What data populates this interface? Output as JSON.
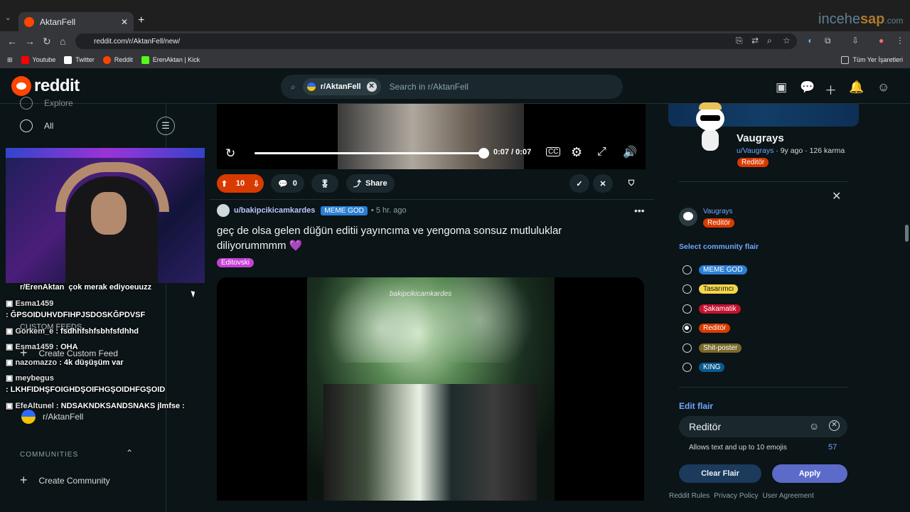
{
  "browser": {
    "tab_title": "AktanFell",
    "url": "reddit.com/r/AktanFell/new/",
    "bookmarks": [
      {
        "label": "Youtube",
        "color": "#ff0000"
      },
      {
        "label": "Twitter",
        "color": "#ffffff"
      },
      {
        "label": "Reddit",
        "color": "#ff4500"
      },
      {
        "label": "ErenAktan | Kick",
        "color": "#53fc18"
      }
    ],
    "bookmarks_folder": "Tüm Yer İşaretleri",
    "watermark_a": "incehe",
    "watermark_b": "sap",
    "watermark_c": ".com"
  },
  "header": {
    "logo": "reddit",
    "search_chip": "r/AktanFell",
    "search_placeholder": "Search in r/AktanFell"
  },
  "sidebar": {
    "explore": "Explore",
    "all": "All",
    "custom_feeds_head": "CUSTOM FEEDS",
    "create_custom_feed": "Create Custom Feed",
    "subreddit": "r/AktanFell",
    "subreddit_ghost": "r/ErenAktan",
    "communities_head": "COMMUNITIES",
    "create_community": "Create Community"
  },
  "stream_chat": [
    {
      "user": "",
      "msg": "çok merak ediyoeuuzz"
    },
    {
      "user": "Esma1459",
      "msg": ": ĞPSOIDUHVDFIHPJSDOSKĞPDVSF"
    },
    {
      "user": "Gorkem_e",
      "msg": ": fsdhhfshfsbhfsfdhhd"
    },
    {
      "user": "Esma1459",
      "msg": ": OHA"
    },
    {
      "user": "nazomazzo",
      "msg": ": 4k düşüşüm var"
    },
    {
      "user": "meybegus",
      "msg": ": LKHFIDHŞFOIGHDŞOIFHGŞOIDHFGŞOID"
    },
    {
      "user": "EfeAltunel",
      "msg": ": NDSAKNDKSANDSNAKS jlmfse :"
    }
  ],
  "video1": {
    "time": "0:07 / 0:07",
    "progress": 1.0
  },
  "post1_actions": {
    "votes": "10",
    "comments": "0",
    "share": "Share"
  },
  "post2": {
    "author": "u/bakipcikicamkardes",
    "author_flair": "MEME GOD",
    "time": "5 hr. ago",
    "title": "geç de olsa gelen düğün editii yayıncıma ve yengoma sonsuz mutluluklar diliyorummmm 💜",
    "post_flair": "Editovski",
    "video_watermark": "bakipcikicamkardes"
  },
  "profile": {
    "name": "Vaugrays",
    "username": "u/Vaugrays",
    "age": "9y ago",
    "karma": "126 karma",
    "flair": "Reditör"
  },
  "flair_panel": {
    "user": "Vaugrays",
    "user_flair": "Reditör",
    "select_title": "Select community flair",
    "options": [
      {
        "label": "MEME GOD",
        "bg": "#2a7fd4",
        "fg": "#ffffff",
        "selected": false
      },
      {
        "label": "Tasarımcı",
        "bg": "#f5d74b",
        "fg": "#1a1a1a",
        "selected": false
      },
      {
        "label": "Şakamatik",
        "bg": "#c4122f",
        "fg": "#ffffff",
        "selected": false
      },
      {
        "label": "Reditör",
        "bg": "#d93a00",
        "fg": "#ffffff",
        "selected": true
      },
      {
        "label": "Shit-poster",
        "bg": "#7a6a2a",
        "fg": "#ffffff",
        "selected": false
      },
      {
        "label": "KING",
        "bg": "#0a5b8f",
        "fg": "#ffffff",
        "selected": false
      }
    ],
    "edit_title": "Edit flair",
    "edit_value": "Reditör",
    "hint": "Allows text and up to 10 emojis",
    "count": "57",
    "clear": "Clear Flair",
    "apply": "Apply"
  },
  "footer": [
    "Reddit Rules",
    "Privacy Policy",
    "User Agreement"
  ]
}
